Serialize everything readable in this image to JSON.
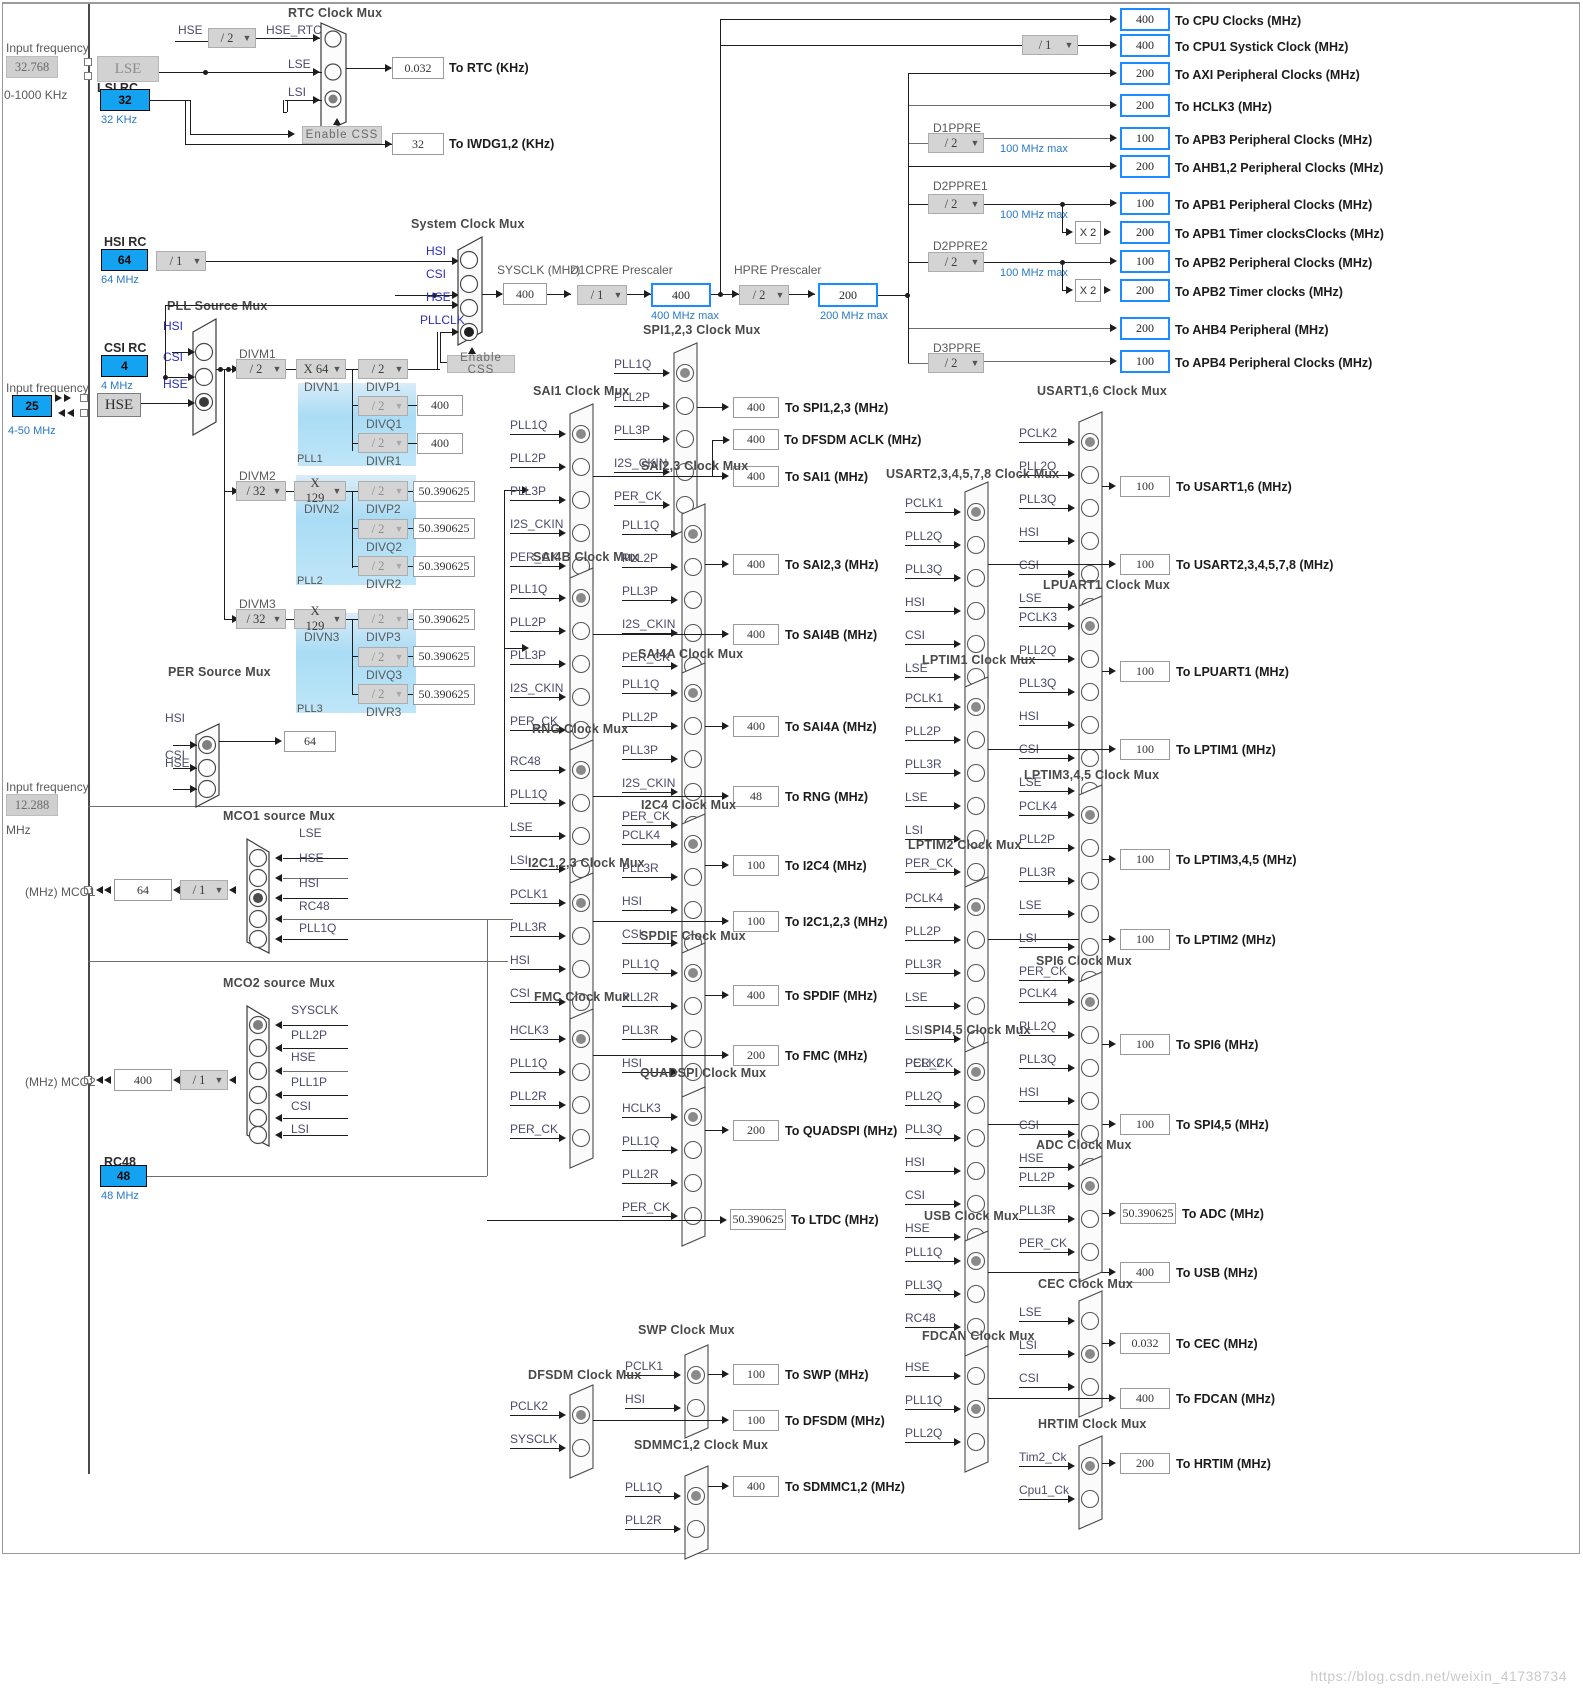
{
  "oscillators": {
    "lse": {
      "input_frequency_label": "Input frequency",
      "input_value": "32.768",
      "range": "0-1000 KHz",
      "name": "LSE"
    },
    "lsi": {
      "title": "LSI RC",
      "value": "32",
      "unit": "32 KHz"
    },
    "hsi": {
      "title": "HSI RC",
      "value": "64",
      "unit": "64 MHz",
      "divider": "/ 1"
    },
    "csi": {
      "title": "CSI RC",
      "value": "4",
      "unit": "4 MHz"
    },
    "hse": {
      "input_frequency_label": "Input frequency",
      "input_value": "25",
      "range": "4-50 MHz",
      "name": "HSE"
    },
    "i2s": {
      "input_frequency_label": "Input frequency",
      "input_value": "12.288",
      "unit": "MHz"
    },
    "rc48": {
      "title": "RC48",
      "value": "48",
      "unit": "48 MHz"
    }
  },
  "rtc": {
    "mux_title": "RTC Clock Mux",
    "hse_label": "HSE",
    "hse_div": "/ 2",
    "hse_rtc_label": "HSE_RTC",
    "inputs": [
      "HSE_RTC",
      "LSE",
      "LSI"
    ],
    "selected": 2,
    "enable_css": "Enable CSS",
    "rtc_value": "0.032",
    "rtc_out": "To RTC (KHz)",
    "iwdg_value": "32",
    "iwdg_out": "To IWDG1,2 (KHz)"
  },
  "pll_source_mux": {
    "title": "PLL Source Mux",
    "inputs": [
      "HSI",
      "CSI",
      "HSE"
    ],
    "selected": 2
  },
  "system_clock_mux": {
    "title": "System Clock Mux",
    "inputs": [
      "HSI",
      "CSI",
      "HSE",
      "PLLCLK"
    ],
    "selected": 3,
    "enable_css": "Enable CSS",
    "sysclk_label": "SYSCLK (MHz)",
    "sysclk_value": "400"
  },
  "prescalers": {
    "d1cpre": {
      "label": "D1CPRE Prescaler",
      "value": "/ 1",
      "out": "400",
      "max": "400 MHz max"
    },
    "hpre": {
      "label": "HPRE Prescaler",
      "value": "/ 2",
      "out": "200",
      "max": "200 MHz max"
    },
    "d1ppre": {
      "label": "D1PPRE",
      "value": "/ 2",
      "max": "100 MHz max"
    },
    "d2ppre1": {
      "label": "D2PPRE1",
      "value": "/ 2",
      "max": "100 MHz max"
    },
    "d2ppre2": {
      "label": "D2PPRE2",
      "value": "/ 2",
      "max": "100 MHz max"
    },
    "d3ppre": {
      "label": "D3PPRE",
      "value": "/ 2"
    },
    "cpu1_systick": {
      "value": "/ 1"
    },
    "mul2_a": "X 2",
    "mul2_b": "X 2"
  },
  "plls": [
    {
      "name": "PLL1",
      "divm": {
        "label": "DIVM1",
        "value": "/ 2"
      },
      "divn": {
        "label": "DIVN1",
        "value": "X 64"
      },
      "outs": [
        {
          "label": "DIVP1",
          "value": "/ 2",
          "dim": false,
          "out": ""
        },
        {
          "label": "DIVQ1",
          "value": "/ 2",
          "dim": true,
          "out": "400"
        },
        {
          "label": "DIVR1",
          "value": "/ 2",
          "dim": true,
          "out": "400"
        }
      ]
    },
    {
      "name": "PLL2",
      "divm": {
        "label": "DIVM2",
        "value": "/ 32"
      },
      "divn": {
        "label": "DIVN2",
        "value": "X 129"
      },
      "outs": [
        {
          "label": "DIVP2",
          "value": "/ 2",
          "dim": true,
          "out": "50.390625"
        },
        {
          "label": "DIVQ2",
          "value": "/ 2",
          "dim": true,
          "out": "50.390625"
        },
        {
          "label": "DIVR2",
          "value": "/ 2",
          "dim": true,
          "out": "50.390625"
        }
      ]
    },
    {
      "name": "PLL3",
      "divm": {
        "label": "DIVM3",
        "value": "/ 32"
      },
      "divn": {
        "label": "DIVN3",
        "value": "X 129"
      },
      "outs": [
        {
          "label": "DIVP3",
          "value": "/ 2",
          "dim": true,
          "out": "50.390625"
        },
        {
          "label": "DIVQ3",
          "value": "/ 2",
          "dim": true,
          "out": "50.390625"
        },
        {
          "label": "DIVR3",
          "value": "/ 2",
          "dim": true,
          "out": "50.390625"
        }
      ]
    }
  ],
  "per_source_mux": {
    "title": "PER Source Mux",
    "inputs": [
      "HSI",
      "CSI",
      "HSE"
    ],
    "selected": 0,
    "value": "64"
  },
  "mco1": {
    "title": "MCO1 source Mux",
    "inputs": [
      "LSE",
      "HSE",
      "HSI",
      "RC48",
      "PLL1Q"
    ],
    "selected": 2,
    "divider": "/ 1",
    "value": "64",
    "pin_label": "(MHz) MCO1"
  },
  "mco2": {
    "title": "MCO2 source Mux",
    "inputs": [
      "SYSCLK",
      "PLL2P",
      "HSE",
      "PLL1P",
      "CSI",
      "LSI"
    ],
    "selected": 0,
    "divider": "/ 1",
    "value": "400",
    "pin_label": "(MHz) MCO2"
  },
  "bus_outputs": [
    {
      "value": "400",
      "label": "To CPU Clocks (MHz)",
      "hl": true
    },
    {
      "value": "400",
      "label": "To CPU1 Systick Clock (MHz)",
      "hl": true
    },
    {
      "value": "200",
      "label": "To AXI Peripheral Clocks (MHz)",
      "hl": true
    },
    {
      "value": "200",
      "label": "To HCLK3 (MHz)",
      "hl": true
    },
    {
      "value": "100",
      "label": "To APB3 Peripheral Clocks (MHz)",
      "hl": true
    },
    {
      "value": "200",
      "label": "To AHB1,2 Peripheral Clocks (MHz)",
      "hl": true
    },
    {
      "value": "100",
      "label": "To APB1 Peripheral Clocks (MHz)",
      "hl": true
    },
    {
      "value": "200",
      "label": "To APB1 Timer clocksClocks (MHz)",
      "hl": true
    },
    {
      "value": "100",
      "label": "To APB2 Peripheral Clocks (MHz)",
      "hl": true
    },
    {
      "value": "200",
      "label": "To APB2 Timer clocks (MHz)",
      "hl": true
    },
    {
      "value": "200",
      "label": "To AHB4 Peripheral (MHz)",
      "hl": true
    },
    {
      "value": "100",
      "label": "To APB4 Peripheral Clocks (MHz)",
      "hl": true
    }
  ],
  "peripheral_muxes": [
    {
      "title": "SPI1,2,3 Clock Mux",
      "inputs": [
        "PLL1Q",
        "PLL2P",
        "PLL3P",
        "I2S_CKIN",
        "PER_CK"
      ],
      "selected": 0,
      "out_value": "400",
      "out_label": "To SPI1,2,3 (MHz)"
    },
    {
      "title": "SAI1 Clock Mux",
      "inputs": [
        "PLL1Q",
        "PLL2P",
        "PLL3P",
        "I2S_CKIN",
        "PER_CK"
      ],
      "selected": 0,
      "out_value": "400",
      "out_label": "To SAI1 (MHz)"
    },
    {
      "title": "SAI2,3 Clock Mux",
      "inputs": [
        "PLL1Q",
        "PLL2P",
        "PLL3P",
        "I2S_CKIN",
        "PER_CK"
      ],
      "selected": 0,
      "out_value": "400",
      "out_label": "To SAI2,3 (MHz)"
    },
    {
      "title": "SAI4B Clock Mux",
      "inputs": [
        "PLL1Q",
        "PLL2P",
        "PLL3P",
        "I2S_CKIN",
        "PER_CK"
      ],
      "selected": 0,
      "out_value": "400",
      "out_label": "To SAI4B (MHz)"
    },
    {
      "title": "SAI4A Clock Mux",
      "inputs": [
        "PLL1Q",
        "PLL2P",
        "PLL3P",
        "I2S_CKIN",
        "PER_CK"
      ],
      "selected": 0,
      "out_value": "400",
      "out_label": "To SAI4A (MHz)"
    },
    {
      "title": "RNG Clock Mux",
      "inputs": [
        "RC48",
        "PLL1Q",
        "LSE",
        "LSI"
      ],
      "selected": 0,
      "out_value": "48",
      "out_label": "To RNG (MHz)"
    },
    {
      "title": "I2C4 Clock Mux",
      "inputs": [
        "PCLK4",
        "PLL3R",
        "HSI",
        "CSI"
      ],
      "selected": 0,
      "out_value": "100",
      "out_label": "To I2C4 (MHz)"
    },
    {
      "title": "I2C1,2,3 Clock Mux",
      "inputs": [
        "PCLK1",
        "PLL3R",
        "HSI",
        "CSI"
      ],
      "selected": 0,
      "out_value": "100",
      "out_label": "To I2C1,2,3 (MHz)"
    },
    {
      "title": "SPDIF Clock Mux",
      "inputs": [
        "PLL1Q",
        "PLL2R",
        "PLL3R",
        "HSI"
      ],
      "selected": 0,
      "out_value": "400",
      "out_label": "To SPDIF (MHz)"
    },
    {
      "title": "FMC Clock Mux",
      "inputs": [
        "HCLK3",
        "PLL1Q",
        "PLL2R",
        "PER_CK"
      ],
      "selected": 0,
      "out_value": "200",
      "out_label": "To FMC (MHz)"
    },
    {
      "title": "QUADSPI Clock Mux",
      "inputs": [
        "HCLK3",
        "PLL1Q",
        "PLL2R",
        "PER_CK"
      ],
      "selected": 0,
      "out_value": "200",
      "out_label": "To QUADSPI (MHz)"
    },
    {
      "title": "USART1,6 Clock Mux",
      "inputs": [
        "PCLK2",
        "PLL2Q",
        "PLL3Q",
        "HSI",
        "CSI",
        "LSE"
      ],
      "selected": 0,
      "out_value": "100",
      "out_label": "To USART1,6 (MHz)"
    },
    {
      "title": "USART2,3,4,5,7,8 Clock Mux",
      "inputs": [
        "PCLK1",
        "PLL2Q",
        "PLL3Q",
        "HSI",
        "CSI",
        "LSE"
      ],
      "selected": 0,
      "out_value": "100",
      "out_label": "To USART2,3,4,5,7,8 (MHz)"
    },
    {
      "title": "LPUART1 Clock Mux",
      "inputs": [
        "PCLK3",
        "PLL2Q",
        "PLL3Q",
        "HSI",
        "CSI",
        "LSE"
      ],
      "selected": 0,
      "out_value": "100",
      "out_label": "To LPUART1 (MHz)"
    },
    {
      "title": "LPTIM1 Clock Mux",
      "inputs": [
        "PCLK1",
        "PLL2P",
        "PLL3R",
        "LSE",
        "LSI",
        "PER_CK"
      ],
      "selected": 0,
      "out_value": "100",
      "out_label": "To LPTIM1 (MHz)"
    },
    {
      "title": "LPTIM2 Clock Mux",
      "inputs": [
        "PCLK4",
        "PLL2P",
        "PLL3R",
        "LSE",
        "LSI",
        "PER_CK"
      ],
      "selected": 0,
      "out_value": "100",
      "out_label": "To LPTIM2 (MHz)"
    },
    {
      "title": "LPTIM3,4,5 Clock Mux",
      "inputs": [
        "PCLK4",
        "PLL2P",
        "PLL3R",
        "LSE",
        "LSI",
        "PER_CK"
      ],
      "selected": 0,
      "out_value": "100",
      "out_label": "To LPTIM3,4,5 (MHz)"
    },
    {
      "title": "SPI4,5 Clock Mux",
      "inputs": [
        "PCLK2",
        "PLL2Q",
        "PLL3Q",
        "HSI",
        "CSI",
        "HSE"
      ],
      "selected": 0,
      "out_value": "100",
      "out_label": "To SPI4,5 (MHz)"
    },
    {
      "title": "SPI6 Clock Mux",
      "inputs": [
        "PCLK4",
        "PLL2Q",
        "PLL3Q",
        "HSI",
        "CSI",
        "HSE"
      ],
      "selected": 0,
      "out_value": "100",
      "out_label": "To SPI6 (MHz)"
    },
    {
      "title": "USB Clock Mux",
      "inputs": [
        "PLL1Q",
        "PLL3Q",
        "RC48"
      ],
      "selected": 0,
      "out_value": "400",
      "out_label": "To USB (MHz)"
    },
    {
      "title": "ADC Clock Mux",
      "inputs": [
        "PLL2P",
        "PLL3R",
        "PER_CK"
      ],
      "selected": 0,
      "out_value": "50.390625",
      "out_label": "To ADC (MHz)"
    },
    {
      "title": "CEC Clock Mux",
      "inputs": [
        "LSE",
        "LSI",
        "CSI"
      ],
      "selected": 1,
      "out_value": "0.032",
      "out_label": "To CEC (MHz)"
    },
    {
      "title": "FDCAN Clock Mux",
      "inputs": [
        "HSE",
        "PLL1Q",
        "PLL2Q"
      ],
      "selected": 1,
      "out_value": "400",
      "out_label": "To FDCAN (MHz)"
    },
    {
      "title": "HRTIM Clock Mux",
      "inputs": [
        "Tim2_Ck",
        "Cpu1_Ck"
      ],
      "selected": 0,
      "out_value": "200",
      "out_label": "To HRTIM (MHz)"
    },
    {
      "title": "SWP Clock Mux",
      "inputs": [
        "PCLK1",
        "HSI"
      ],
      "selected": 0,
      "out_value": "100",
      "out_label": "To SWP (MHz)"
    },
    {
      "title": "DFSDM Clock Mux",
      "inputs": [
        "PCLK2",
        "SYSCLK"
      ],
      "selected": 0,
      "out_value": "100",
      "out_label": "To DFSDM (MHz)"
    },
    {
      "title": "SDMMC1,2 Clock Mux",
      "inputs": [
        "PLL1Q",
        "PLL2R"
      ],
      "selected": 0,
      "out_value": "400",
      "out_label": "To SDMMC1,2 (MHz)"
    }
  ],
  "extra_outputs": [
    {
      "value": "400",
      "label": "To DFSDM ACLK (MHz)"
    },
    {
      "value": "50.390625",
      "label": "To LTDC (MHz)"
    }
  ],
  "watermark": "https://blog.csdn.net/weixin_41738734",
  "colors": {
    "accent_cyan": "#14a3f0",
    "highlight_border": "#1a8cff",
    "blue_text": "#2878c8",
    "signal_text": "#2b2bbd"
  }
}
